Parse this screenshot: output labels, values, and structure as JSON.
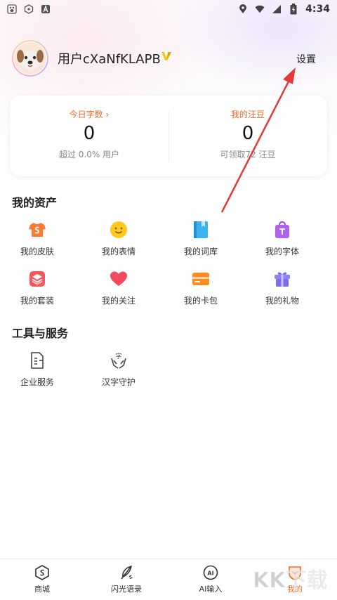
{
  "status_bar": {
    "time": "4:34",
    "left_icons": [
      "paw-icon",
      "hexagon-icon",
      "a-icon"
    ],
    "right_icons": [
      "location-icon",
      "wifi-icon",
      "signal-icon",
      "battery-icon"
    ]
  },
  "profile": {
    "username": "用户cXaNfKLAPB",
    "settings_label": "设置"
  },
  "stats": {
    "today_label": "今日字数",
    "today_value": "0",
    "today_sub": "超过 0.0% 用户",
    "beans_label": "我的汪豆",
    "beans_value": "0",
    "beans_sub": "可领取72 汪豆"
  },
  "assets": {
    "title": "我的资产",
    "items": [
      {
        "label": "我的皮肤",
        "icon": "shirt-icon"
      },
      {
        "label": "我的表情",
        "icon": "smile-icon"
      },
      {
        "label": "我的词库",
        "icon": "book-icon"
      },
      {
        "label": "我的字体",
        "icon": "bag-icon"
      },
      {
        "label": "我的套装",
        "icon": "layers-icon"
      },
      {
        "label": "我的关注",
        "icon": "heart-icon"
      },
      {
        "label": "我的卡包",
        "icon": "card-icon"
      },
      {
        "label": "我的礼物",
        "icon": "gift-icon"
      }
    ]
  },
  "tools": {
    "title": "工具与服务",
    "items": [
      {
        "label": "企业服务",
        "icon": "document-icon"
      },
      {
        "label": "汉字守护",
        "icon": "hands-char-icon"
      }
    ]
  },
  "bottom_nav": {
    "tabs": [
      {
        "label": "商城",
        "icon": "shop-icon"
      },
      {
        "label": "闪光语录",
        "icon": "quill-icon"
      },
      {
        "label": "AI输入",
        "icon": "ai-icon"
      },
      {
        "label": "我的",
        "icon": "me-icon",
        "active": true
      }
    ]
  },
  "watermark": "KK下载",
  "colors": {
    "accent": "#f06a2a",
    "annotation_arrow": "#e53935"
  }
}
